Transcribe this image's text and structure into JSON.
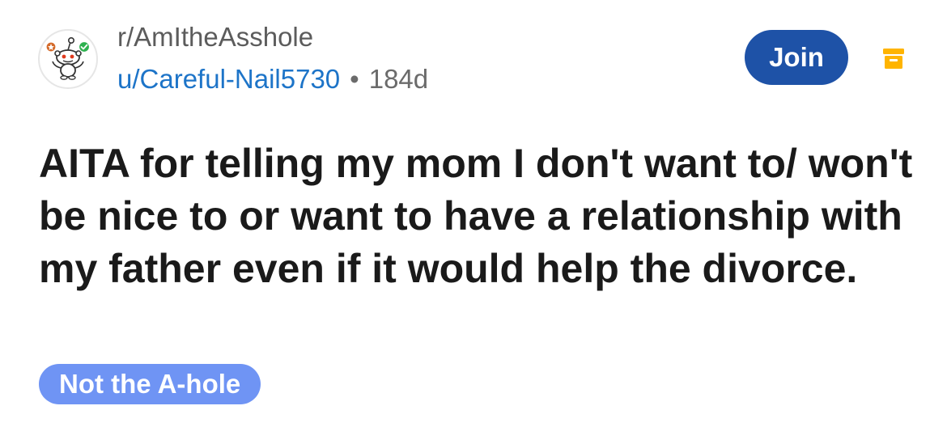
{
  "header": {
    "subreddit": "r/AmItheAsshole",
    "username": "u/Careful-Nail5730",
    "separator": "•",
    "age": "184d",
    "join_label": "Join",
    "avatar_icon": "snoo-mascot-icon",
    "archive_icon": "archive-icon"
  },
  "post": {
    "title": "AITA for telling my mom I don't want to/ won't be nice to or want to have a relationship with my father even if it would help the divorce.",
    "flair": "Not the A-hole"
  },
  "colors": {
    "join_bg": "#1e52a7",
    "username": "#1d74c8",
    "flair_bg": "#6f94f4",
    "archive_icon": "#ffb400",
    "verified_badge": "#2eb14f",
    "award_badge": "#d46a2a"
  }
}
